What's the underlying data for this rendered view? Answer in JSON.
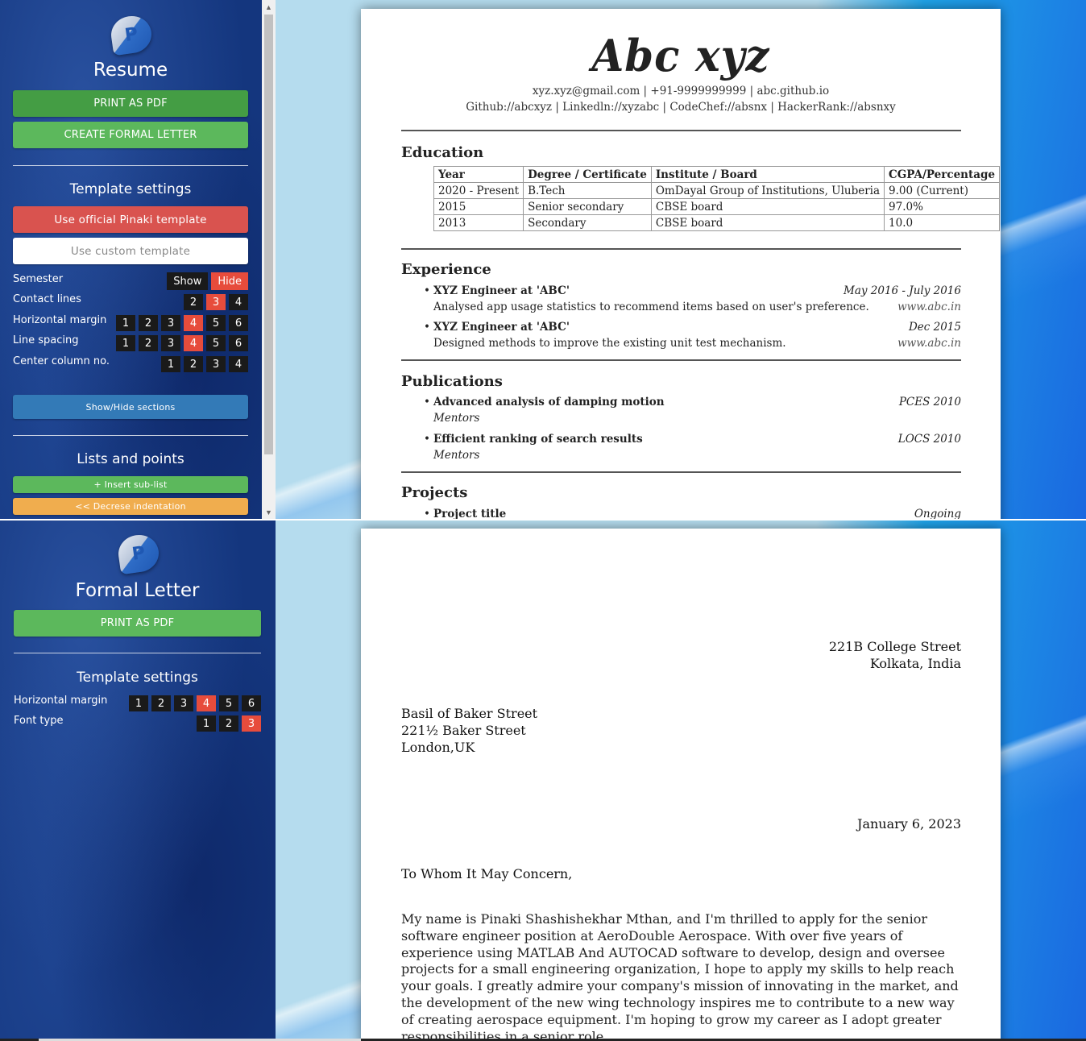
{
  "resume_panel": {
    "sidebar": {
      "title": "Resume",
      "print_label": "PRINT AS PDF",
      "formal_letter_label": "CREATE FORMAL LETTER",
      "template_settings_title": "Template settings",
      "official_template_label": "Use official Pinaki template",
      "custom_template_label": "Use custom template",
      "settings": {
        "semester": {
          "label": "Semester",
          "options": [
            "Show",
            "Hide"
          ],
          "selected": "Hide"
        },
        "contact_lines": {
          "label": "Contact lines",
          "options": [
            "2",
            "3",
            "4"
          ],
          "selected": "3"
        },
        "horizontal_margin": {
          "label": "Horizontal margin",
          "options": [
            "1",
            "2",
            "3",
            "4",
            "5",
            "6"
          ],
          "selected": "4"
        },
        "line_spacing": {
          "label": "Line spacing",
          "options": [
            "1",
            "2",
            "3",
            "4",
            "5",
            "6"
          ],
          "selected": "4"
        },
        "center_column": {
          "label": "Center column no.",
          "options": [
            "1",
            "2",
            "3",
            "4"
          ],
          "selected": ""
        }
      },
      "show_hide_label": "Show/Hide sections",
      "lists_title": "Lists and points",
      "insert_sublist_label": "+ Insert sub-list",
      "decrease_indent_label": "<< Decrese indentation"
    },
    "resume": {
      "name": "Abc xyz",
      "contact_line1": "xyz.xyz@gmail.com  |  +91-9999999999  |  abc.github.io",
      "contact_line2": "Github://abcxyz  |  Linkedln://xyzabc  |  CodeChef://absnx  |  HackerRank://absnxy",
      "education_title": "Education",
      "education_headers": [
        "Year",
        "Degree / Certificate",
        "Institute / Board",
        "CGPA/Percentage"
      ],
      "education_rows": [
        [
          "2020 - Present",
          "B.Tech",
          "OmDayal Group of Institutions, Uluberia",
          "9.00 (Current)"
        ],
        [
          "2015",
          "Senior secondary",
          "CBSE board",
          "97.0%"
        ],
        [
          "2013",
          "Secondary",
          "CBSE board",
          "10.0"
        ]
      ],
      "experience_title": "Experience",
      "experience": [
        {
          "title": "XYZ Engineer at 'ABC'",
          "date": "May 2016 - July 2016",
          "desc": "Analysed app usage statistics to recommend items based on user's preference.",
          "link": "www.abc.in"
        },
        {
          "title": "XYZ Engineer at 'ABC'",
          "date": "Dec 2015",
          "desc": "Designed methods to improve the existing unit test mechanism.",
          "link": "www.abc.in"
        }
      ],
      "publications_title": "Publications",
      "publications": [
        {
          "title": "Advanced analysis of damping motion",
          "venue": "PCES 2010",
          "sub": "Mentors"
        },
        {
          "title": "Efficient ranking of search results",
          "venue": "LOCS 2010",
          "sub": "Mentors"
        }
      ],
      "projects_title": "Projects",
      "projects": [
        {
          "title": "Project title",
          "status": "Ongoing"
        }
      ]
    }
  },
  "letter_panel": {
    "sidebar": {
      "title": "Formal Letter",
      "print_label": "PRINT AS PDF",
      "template_settings_title": "Template settings",
      "settings": {
        "horizontal_margin": {
          "label": "Horizontal margin",
          "options": [
            "1",
            "2",
            "3",
            "4",
            "5",
            "6"
          ],
          "selected": "4"
        },
        "font_type": {
          "label": "Font type",
          "options": [
            "1",
            "2",
            "3"
          ],
          "selected": "3"
        }
      }
    },
    "letter": {
      "sender_line1": "221B College Street",
      "sender_line2": "Kolkata, India",
      "recipient_line1": "Basil of Baker Street",
      "recipient_line2": "221½ Baker Street",
      "recipient_line3": "London,UK",
      "date": "January 6, 2023",
      "salutation": "To Whom It May Concern,",
      "body": "My name is Pinaki Shashishekhar Mthan, and I'm thrilled to apply for the senior software engineer position at AeroDouble Aerospace. With over five years of experience using MATLAB And AUTOCAD software to develop, design and oversee projects for a small engineering organization, I hope to apply my skills to help reach your goals. I greatly admire your company's mission of innovating in the market, and the development of the new wing technology inspires me to contribute to a new way of creating aerospace equipment. I'm hoping to grow my career as I adopt greater responsibilities in a senior role."
    }
  },
  "colors": {
    "sidebar_bg": "#14367e",
    "green": "#5cb85c",
    "red": "#d9534f",
    "blue": "#337ab7",
    "orange": "#f0ad4e",
    "option_active": "#e74c3c"
  },
  "icons": {
    "logo": "pinaki-logo-icon",
    "scroll_up": "chevron-up-icon",
    "scroll_down": "chevron-down-icon"
  }
}
